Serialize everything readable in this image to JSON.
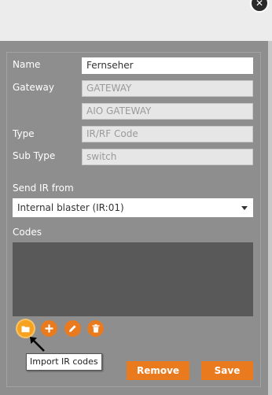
{
  "window": {
    "close_symbol": "✕"
  },
  "form": {
    "name_label": "Name",
    "name_value": "Fernseher",
    "gateway_label": "Gateway",
    "gateway_value": "GATEWAY",
    "gateway_name_value": "AIO GATEWAY",
    "type_label": "Type",
    "type_value": "IR/RF Code",
    "subtype_label": "Sub Type",
    "subtype_value": "switch",
    "send_ir_label": "Send IR from",
    "send_ir_selected": "Internal blaster (IR:01)",
    "codes_label": "Codes"
  },
  "toolbar": {
    "icons": [
      "folder-icon",
      "plus-icon",
      "pencil-icon",
      "trash-icon"
    ],
    "tooltip": "Import IR codes"
  },
  "actions": {
    "remove_label": "Remove",
    "save_label": "Save"
  },
  "colors": {
    "accent": "#ea7a1e",
    "accent_active": "#f7a21e",
    "panel": "#8e8e8e",
    "codes_area": "#595959"
  }
}
